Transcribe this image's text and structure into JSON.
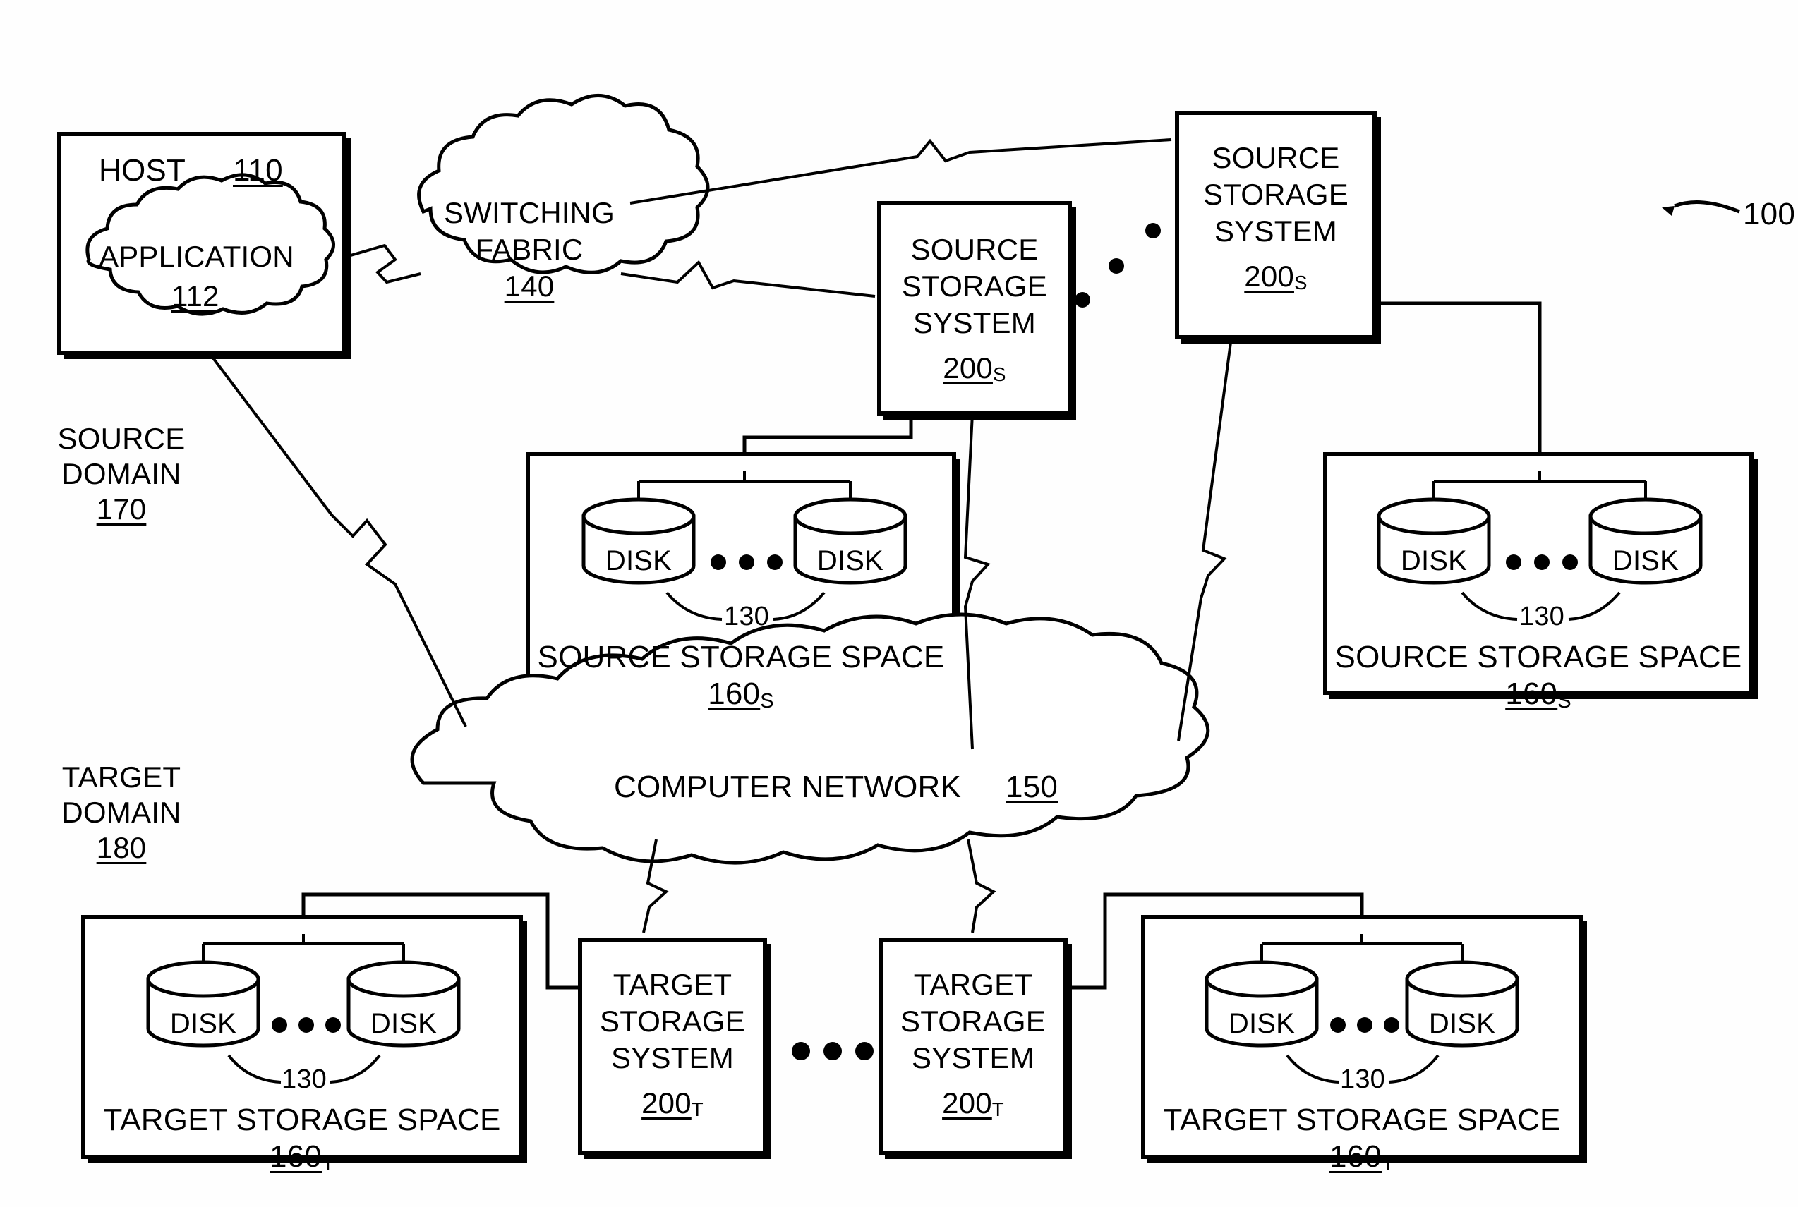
{
  "figure": {
    "reference_numeral": "100"
  },
  "domains": {
    "source": {
      "line1": "SOURCE",
      "line2": "DOMAIN",
      "ref": "170"
    },
    "target": {
      "line1": "TARGET",
      "line2": "DOMAIN",
      "ref": "180"
    }
  },
  "host": {
    "title": "HOST",
    "ref": "110",
    "application": {
      "title": "APPLICATION",
      "ref": "112"
    }
  },
  "switching_fabric": {
    "line1": "SWITCHING",
    "line2": "FABRIC",
    "ref": "140"
  },
  "computer_network": {
    "title": "COMPUTER NETWORK",
    "ref": "150"
  },
  "source_storage_systems": [
    {
      "line1": "SOURCE",
      "line2": "STORAGE",
      "line3": "SYSTEM",
      "ref": "200",
      "sub": "S"
    },
    {
      "line1": "SOURCE",
      "line2": "STORAGE",
      "line3": "SYSTEM",
      "ref": "200",
      "sub": "S"
    }
  ],
  "target_storage_systems": [
    {
      "line1": "TARGET",
      "line2": "STORAGE",
      "line3": "SYSTEM",
      "ref": "200",
      "sub": "T"
    },
    {
      "line1": "TARGET",
      "line2": "STORAGE",
      "line3": "SYSTEM",
      "ref": "200",
      "sub": "T"
    }
  ],
  "source_storage_spaces": [
    {
      "title": "SOURCE STORAGE SPACE",
      "ref": "160",
      "sub": "S",
      "disk_label_left": "DISK",
      "disk_label_right": "DISK",
      "disk_ref": "130"
    },
    {
      "title": "SOURCE STORAGE SPACE",
      "ref": "160",
      "sub": "S",
      "disk_label_left": "DISK",
      "disk_label_right": "DISK",
      "disk_ref": "130"
    }
  ],
  "target_storage_spaces": [
    {
      "title": "TARGET STORAGE SPACE",
      "ref": "160",
      "sub": "T",
      "disk_label_left": "DISK",
      "disk_label_right": "DISK",
      "disk_ref": "130"
    },
    {
      "title": "TARGET STORAGE SPACE",
      "ref": "160",
      "sub": "T",
      "disk_label_left": "DISK",
      "disk_label_right": "DISK",
      "disk_ref": "130"
    }
  ],
  "colors": {
    "ink": "#000000",
    "paper": "#fefefe"
  }
}
